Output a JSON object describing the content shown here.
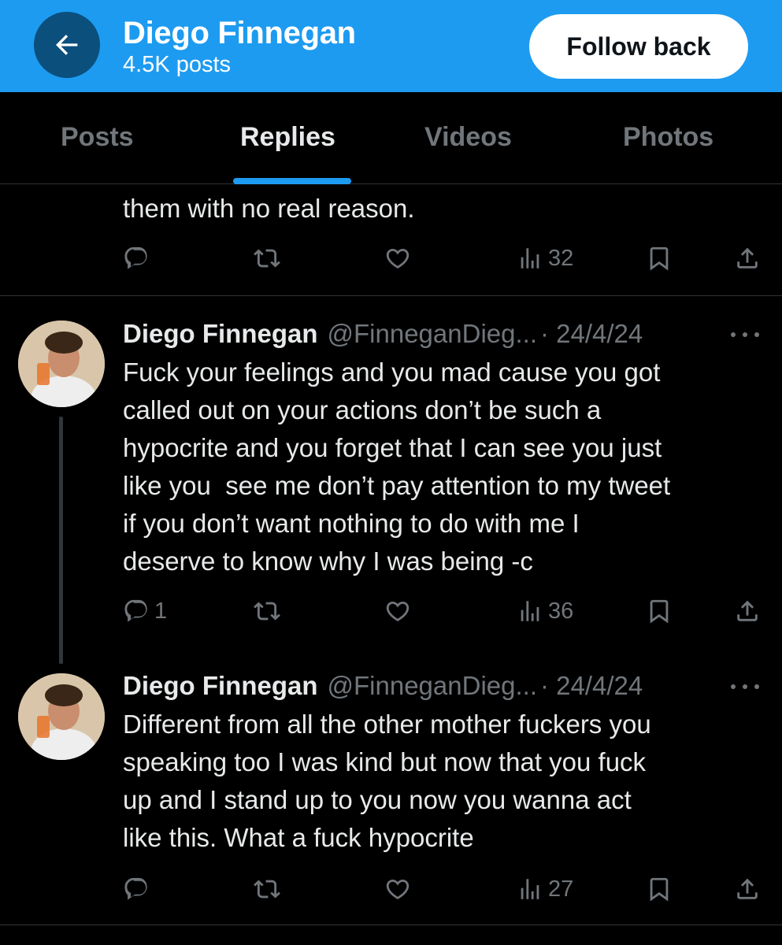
{
  "header": {
    "title": "Diego Finnegan",
    "subtitle": "4.5K posts",
    "follow_label": "Follow back",
    "colors": {
      "bar": "#1d9bf0",
      "back_button": "#0b4f7d"
    }
  },
  "tabs": [
    {
      "label": "Posts",
      "active": false
    },
    {
      "label": "Replies",
      "active": true
    },
    {
      "label": "Videos",
      "active": false
    },
    {
      "label": "Photos",
      "active": false
    }
  ],
  "posts": [
    {
      "text": "them with no real reason.",
      "replies": "",
      "views": "32"
    },
    {
      "name": "Diego Finnegan",
      "handle": "@FinneganDieg...",
      "date": "· 24/4/24",
      "text": "Fuck your feelings and you mad cause you got\ncalled out on your actions don’t be such a\nhypocrite and you forget that I can see you just\nlike you  see me don’t pay attention to my tweet\nif you don’t want nothing to do with me I\ndeserve to know why I was being -c",
      "replies": "1",
      "views": "36"
    },
    {
      "name": "Diego Finnegan",
      "handle": "@FinneganDieg...",
      "date": "· 24/4/24",
      "text": "Different from all the other mother fuckers you\nspeaking too I was kind but now that you fuck\nup and I stand up to you now you wanna act\nlike this. What a fuck hypocrite",
      "replies": "",
      "views": "27"
    }
  ],
  "icons": [
    "back-arrow-icon",
    "reply-icon",
    "retweet-icon",
    "like-icon",
    "views-icon",
    "bookmark-icon",
    "share-icon",
    "more-icon"
  ]
}
